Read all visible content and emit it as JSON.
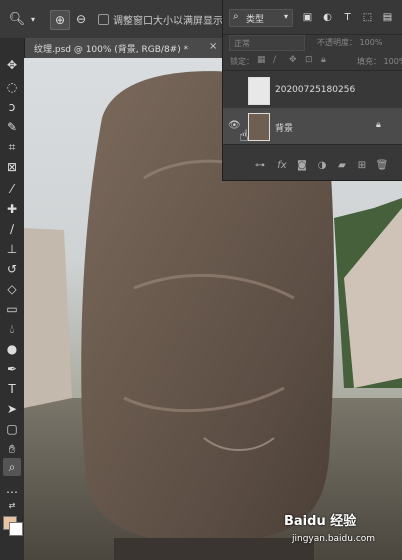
{
  "options_bar": {
    "zoom_in_glyph": "⊕",
    "zoom_out_glyph": "⊖",
    "checkbox_label": "调整窗口大小以满屏显示"
  },
  "document": {
    "tab_title": "纹理.psd @ 100% (背景, RGB/8#) *",
    "close_glyph": "×"
  },
  "layers_panel": {
    "kind_label": "类型",
    "blend_mode": "正常",
    "opacity_label": "不透明度：",
    "opacity_value": "100%",
    "lock_label": "锁定：",
    "fill_label": "填充：",
    "fill_value": "100%",
    "layers": [
      {
        "name": "20200725180256",
        "visible": false,
        "selected": false
      },
      {
        "name": "背景",
        "visible": true,
        "selected": true,
        "locked": true
      }
    ]
  },
  "watermark": {
    "brand": "Baidu 经验",
    "url": "jingyan.baidu.com"
  },
  "colors": {
    "foreground": "#e8c4a3",
    "background": "#ffffff",
    "selected_layer": "#4b4b4b"
  }
}
